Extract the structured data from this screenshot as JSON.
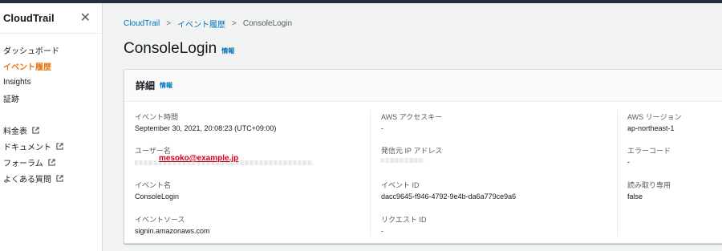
{
  "sidebar": {
    "title": "CloudTrail",
    "items": [
      {
        "label": "ダッシュボード"
      },
      {
        "label": "イベント履歴"
      },
      {
        "label": "Insights"
      },
      {
        "label": "証跡"
      }
    ],
    "links": [
      {
        "label": "料金表"
      },
      {
        "label": "ドキュメント"
      },
      {
        "label": "フォーラム"
      },
      {
        "label": "よくある質問"
      }
    ]
  },
  "breadcrumb": [
    "CloudTrail",
    "イベント履歴",
    "ConsoleLogin"
  ],
  "page": {
    "title": "ConsoleLogin",
    "info_label": "情報"
  },
  "panel": {
    "title": "詳細",
    "info_label": "情報",
    "fields": {
      "event_time": {
        "label": "イベント時間",
        "value": "September 30, 2021, 20:08:23 (UTC+09:00)"
      },
      "user_name": {
        "label": "ユーザー名",
        "annotation": "mesoko@example.jp"
      },
      "event_name": {
        "label": "イベント名",
        "value": "ConsoleLogin"
      },
      "event_source": {
        "label": "イベントソース",
        "value": "signin.amazonaws.com"
      },
      "access_key": {
        "label": "AWS アクセスキー",
        "value": "-"
      },
      "source_ip": {
        "label": "発信元 IP アドレス"
      },
      "event_id": {
        "label": "イベント ID",
        "value": "dacc9645-f946-4792-9e4b-da6a779ce9a6"
      },
      "request_id": {
        "label": "リクエスト ID",
        "value": "-"
      },
      "region": {
        "label": "AWS リージョン",
        "value": "ap-northeast-1"
      },
      "error_code": {
        "label": "エラーコード",
        "value": "-"
      },
      "read_only": {
        "label": "読み取り専用",
        "value": "false"
      }
    }
  },
  "colors": {
    "accent": "#ec7211",
    "link": "#0073bb",
    "annotation": "#d0021b",
    "topbar": "#232f3e"
  }
}
